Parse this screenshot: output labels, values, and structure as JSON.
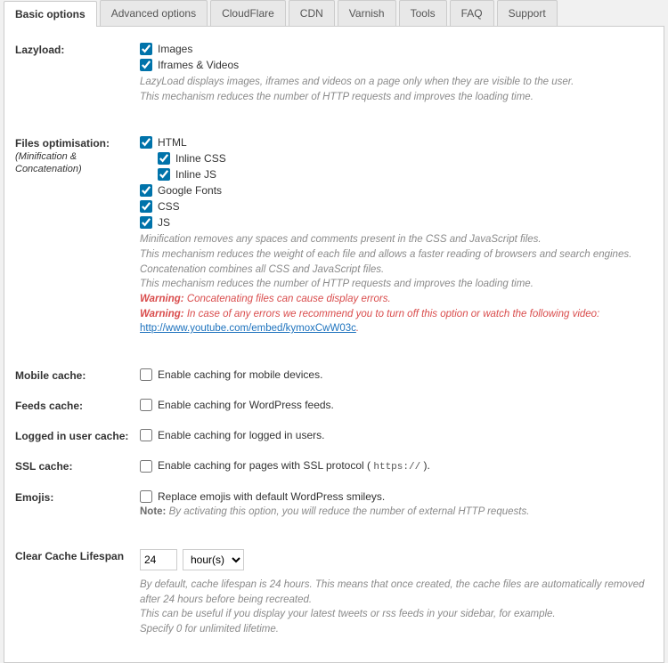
{
  "tabs": {
    "items": [
      {
        "label": "Basic options"
      },
      {
        "label": "Advanced options"
      },
      {
        "label": "CloudFlare"
      },
      {
        "label": "CDN"
      },
      {
        "label": "Varnish"
      },
      {
        "label": "Tools"
      },
      {
        "label": "FAQ"
      },
      {
        "label": "Support"
      }
    ],
    "active_index": 0
  },
  "lazyload": {
    "title": "Lazyload:",
    "images": {
      "label": "Images",
      "checked": true
    },
    "iframes": {
      "label": "Iframes & Videos",
      "checked": true
    },
    "desc1": "LazyLoad displays images, iframes and videos on a page only when they are visible to the user.",
    "desc2": "This mechanism reduces the number of HTTP requests and improves the loading time."
  },
  "files_opt": {
    "title": "Files optimisation:",
    "subtitle": "(Minification & Concatenation)",
    "html": {
      "label": "HTML",
      "checked": true
    },
    "inline_css": {
      "label": "Inline CSS",
      "checked": true
    },
    "inline_js": {
      "label": "Inline JS",
      "checked": true
    },
    "google_fonts": {
      "label": "Google Fonts",
      "checked": true
    },
    "css": {
      "label": "CSS",
      "checked": true
    },
    "js": {
      "label": "JS",
      "checked": true
    },
    "desc1": "Minification removes any spaces and comments present in the CSS and JavaScript files.",
    "desc2": "This mechanism reduces the weight of each file and allows a faster reading of browsers and search engines.",
    "desc3": "Concatenation combines all CSS and JavaScript files.",
    "desc4": "This mechanism reduces the number of HTTP requests and improves the loading time.",
    "warn1_label": "Warning:",
    "warn1_text": " Concatenating files can cause display errors.",
    "warn2_label": "Warning:",
    "warn2_text": " In case of any errors we recommend you to turn off this option or watch the following video: ",
    "warn2_link_text": "http://www.youtube.com/embed/kymoxCwW03c",
    "warn2_suffix": "."
  },
  "mobile_cache": {
    "title": "Mobile cache:",
    "opt": {
      "label": "Enable caching for mobile devices.",
      "checked": false
    }
  },
  "feeds_cache": {
    "title": "Feeds cache:",
    "opt": {
      "label": "Enable caching for WordPress feeds.",
      "checked": false
    }
  },
  "logged_cache": {
    "title": "Logged in user cache:",
    "opt": {
      "label": "Enable caching for logged in users.",
      "checked": false
    }
  },
  "ssl_cache": {
    "title": "SSL cache:",
    "opt_prefix": "Enable caching for pages with SSL protocol ( ",
    "opt_proto": "https://",
    "opt_suffix": " ).",
    "checked": false
  },
  "emojis": {
    "title": "Emojis:",
    "opt": {
      "label": "Replace emojis with default WordPress smileys.",
      "checked": false
    },
    "note_label": "Note:",
    "note_text": " By activating this option, you will reduce the number of external HTTP requests."
  },
  "clear_cache": {
    "title": "Clear Cache Lifespan",
    "value": "24",
    "unit": "hour(s)",
    "desc1": "By default, cache lifespan is 24 hours. This means that once created, the cache files are automatically removed after 24 hours before being recreated.",
    "desc2": "This can be useful if you display your latest tweets or rss feeds in your sidebar, for example.",
    "desc3": "Specify 0 for unlimited lifetime."
  }
}
